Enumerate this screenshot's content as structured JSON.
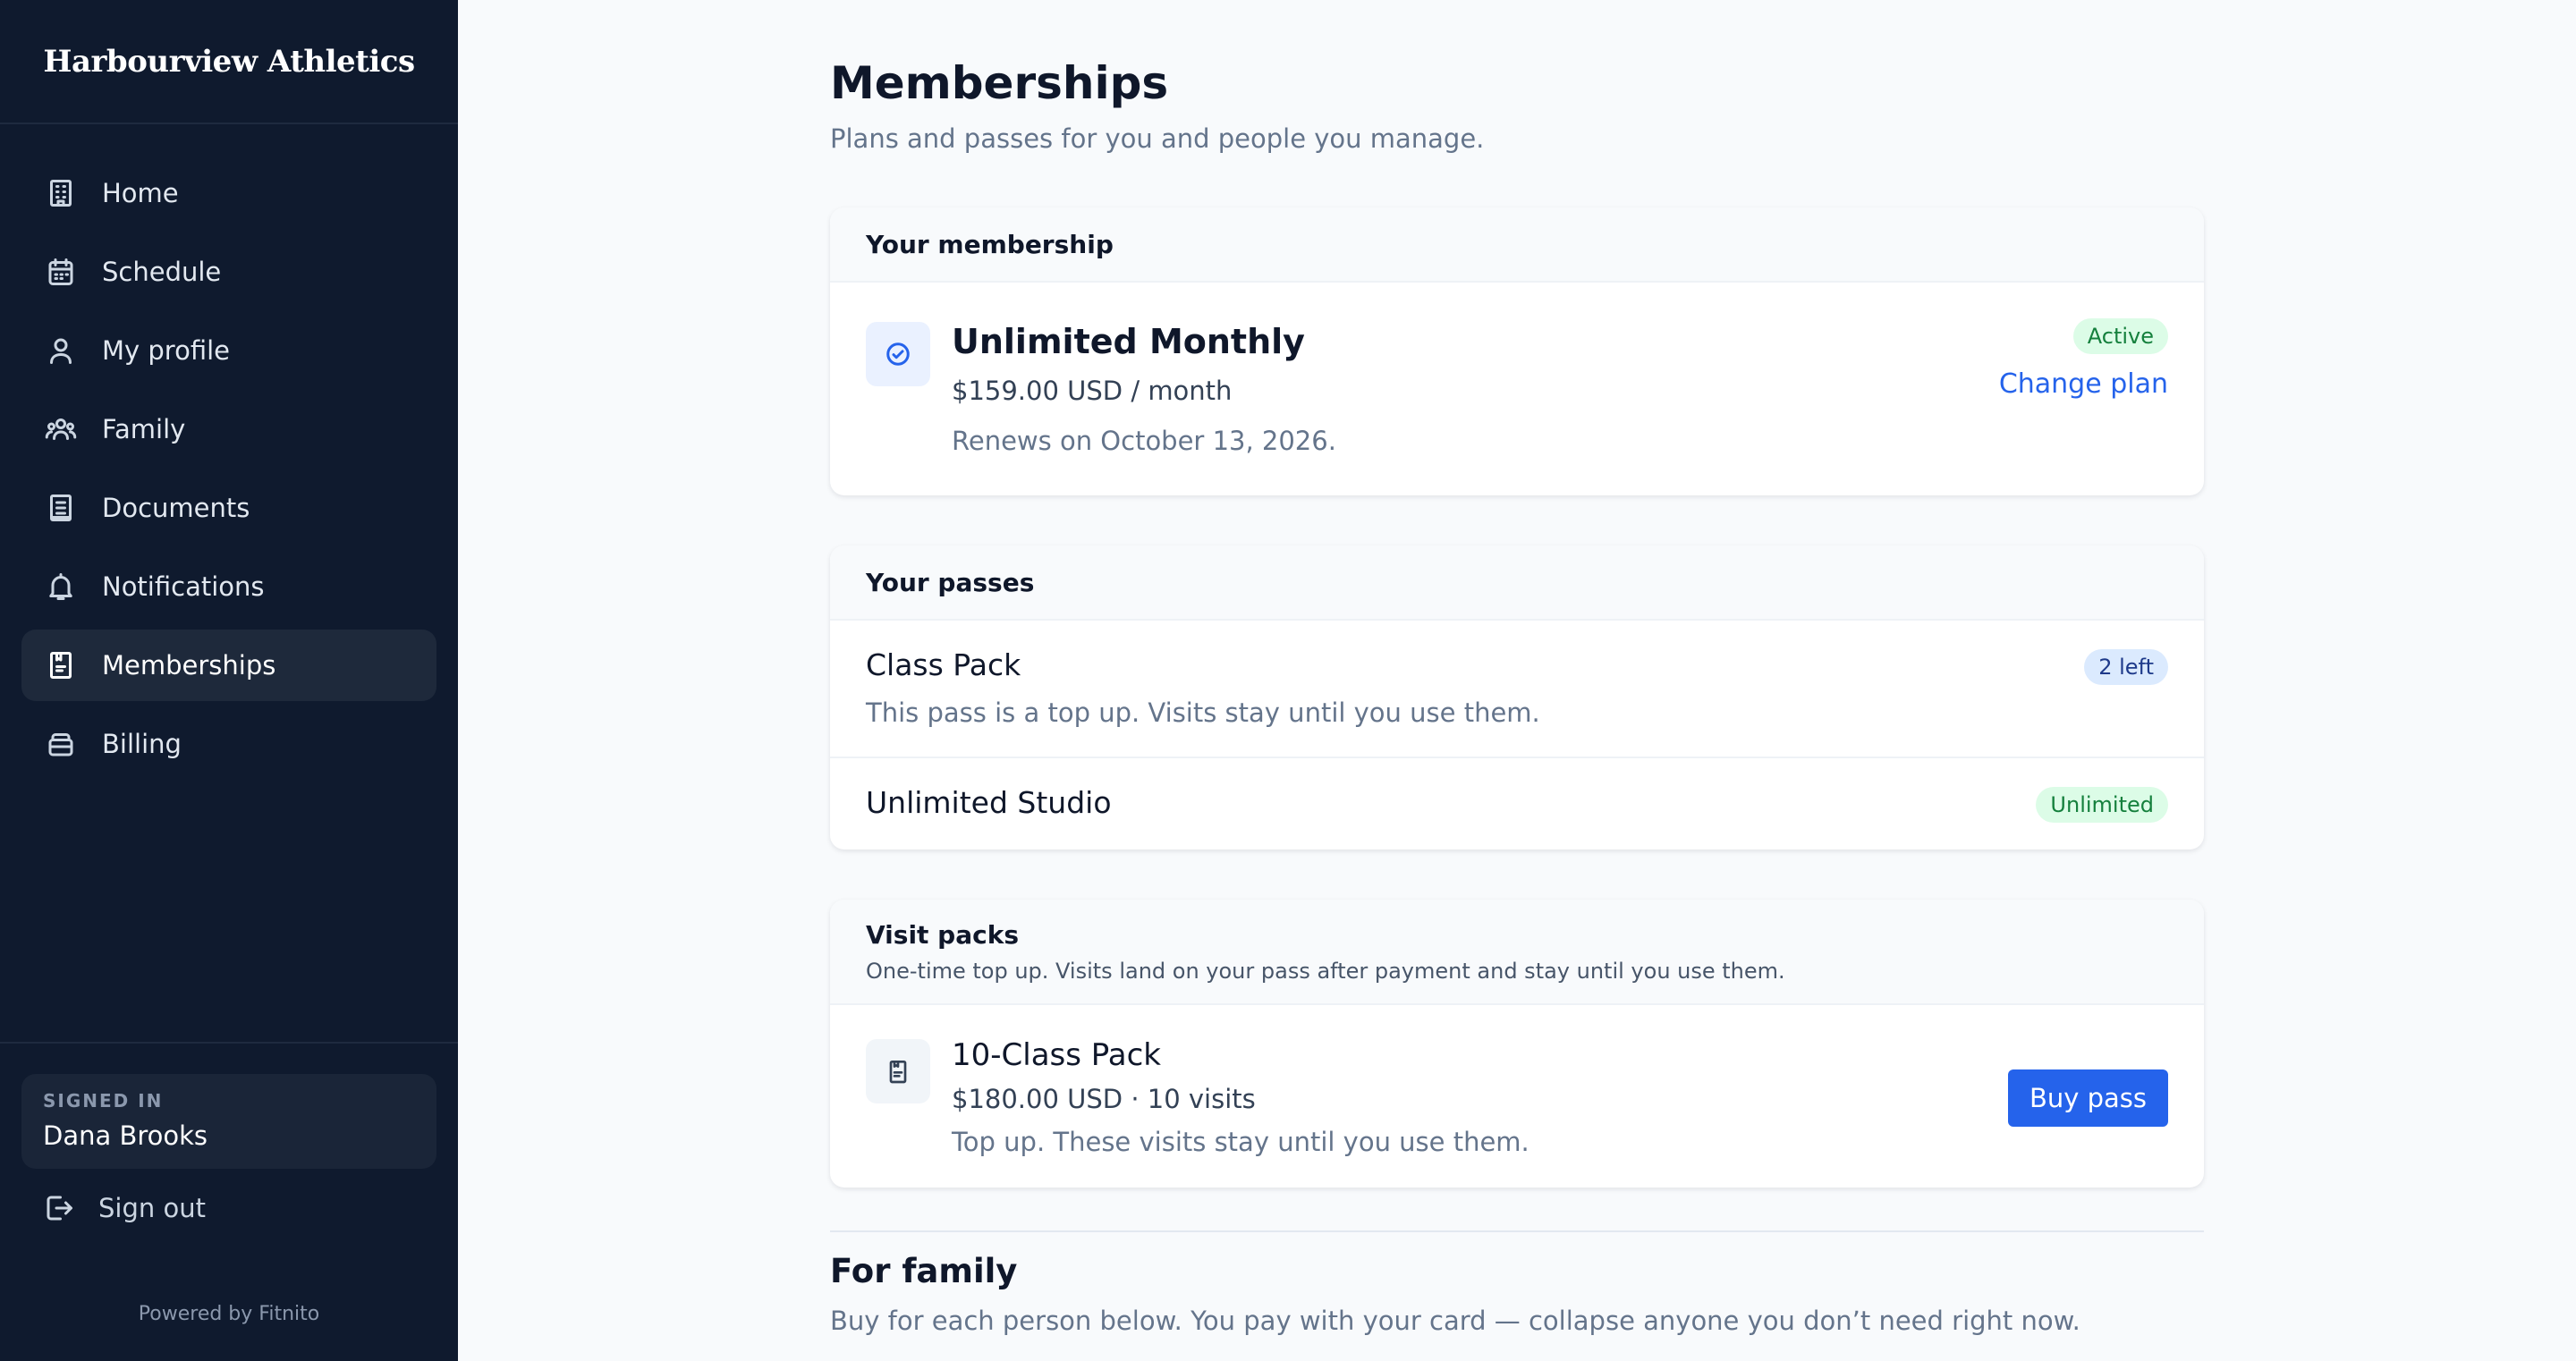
{
  "brand": {
    "name": "Harbourview Athletics"
  },
  "nav": {
    "items": [
      {
        "label": "Home",
        "icon": "building-icon",
        "active": false
      },
      {
        "label": "Schedule",
        "icon": "calendar-icon",
        "active": false
      },
      {
        "label": "My profile",
        "icon": "user-icon",
        "active": false
      },
      {
        "label": "Family",
        "icon": "users-icon",
        "active": false
      },
      {
        "label": "Documents",
        "icon": "document-icon",
        "active": false
      },
      {
        "label": "Notifications",
        "icon": "bell-icon",
        "active": false
      },
      {
        "label": "Memberships",
        "icon": "clipboard-icon",
        "active": true
      },
      {
        "label": "Billing",
        "icon": "wallet-icon",
        "active": false
      }
    ]
  },
  "account": {
    "signed_in_label": "SIGNED IN",
    "user_name": "Dana Brooks",
    "sign_out_label": "Sign out",
    "powered_by": "Powered by Fitnito"
  },
  "page": {
    "title": "Memberships",
    "subtitle": "Plans and passes for you and people you manage."
  },
  "membership": {
    "section_title": "Your membership",
    "plan_name": "Unlimited Monthly",
    "price": "$159.00 USD / month",
    "renewal": "Renews on October 13, 2026.",
    "status": "Active",
    "change_plan_label": "Change plan"
  },
  "passes": {
    "section_title": "Your passes",
    "items": [
      {
        "name": "Class Pack",
        "description": "This pass is a top up. Visits stay until you use them.",
        "badge": "2 left"
      },
      {
        "name": "Unlimited Studio",
        "description": "",
        "badge": "Unlimited"
      }
    ]
  },
  "visit_packs": {
    "section_title": "Visit packs",
    "section_subtitle": "One-time top up. Visits land on your pass after payment and stay until you use them.",
    "items": [
      {
        "name": "10-Class Pack",
        "price": "$180.00 USD · 10 visits",
        "description": "Top up. These visits stay until you use them.",
        "button_label": "Buy pass"
      }
    ]
  },
  "family": {
    "title": "For family",
    "subtitle": "Buy for each person below. You pay with your card — collapse anyone you don’t need right now."
  },
  "colors": {
    "sidebar_bg": "#0f1a2e",
    "accent": "#2563eb",
    "active_badge_bg": "#dcfce7",
    "active_badge_text": "#15803d",
    "count_badge_bg": "#dbeafe"
  }
}
